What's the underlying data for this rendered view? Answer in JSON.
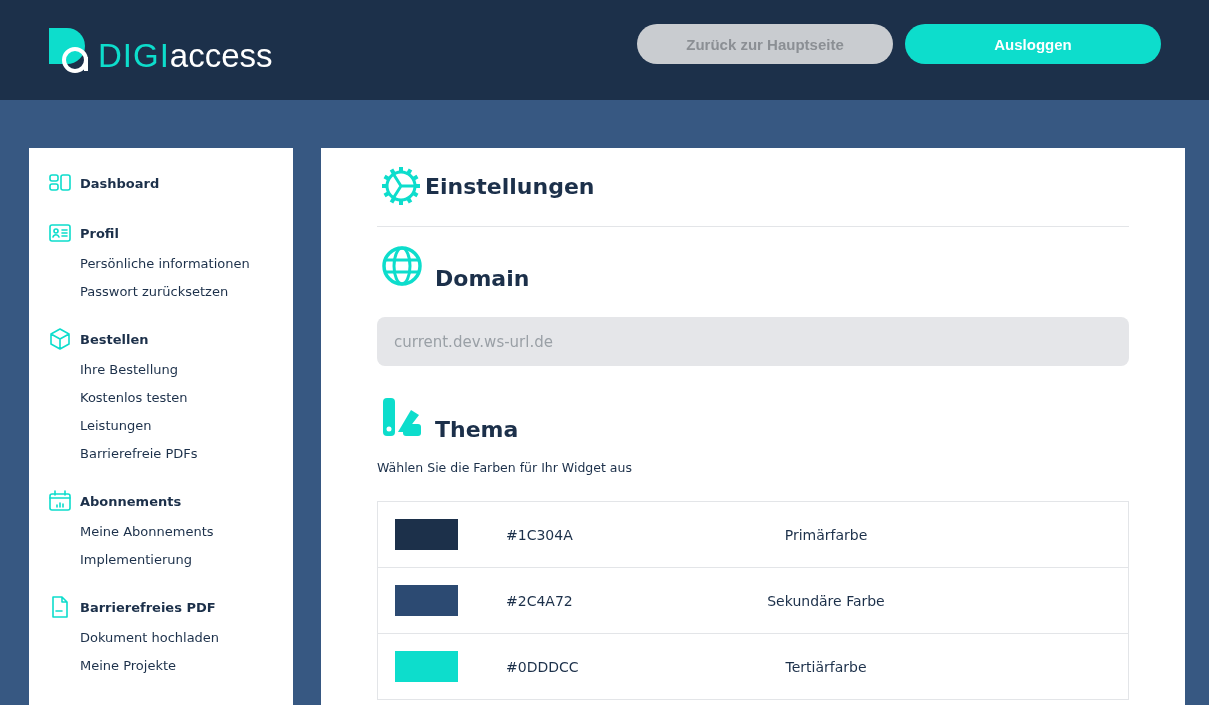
{
  "header": {
    "logo": {
      "part_1": "DIGI",
      "part_2": "access"
    },
    "buttons": [
      {
        "label": "Zurück zur Hauptseite",
        "kind": "secondary"
      },
      {
        "label": "Ausloggen",
        "kind": "primary"
      }
    ]
  },
  "sidebar": {
    "sections": [
      {
        "title": "Dashboard"
      },
      {
        "title": "Profil",
        "items": [
          "Persönliche informationen",
          "Passwort zurücksetzen"
        ]
      },
      {
        "title": "Bestellen",
        "items": [
          "Ihre Bestellung",
          "Kostenlos testen",
          "Leistungen",
          "Barrierefreie PDFs"
        ]
      },
      {
        "title": "Abonnements",
        "items": [
          "Meine Abonnements",
          "Implementierung"
        ]
      },
      {
        "title": "Barrierefreies PDF",
        "items": [
          "Dokument hochladen",
          "Meine Projekte"
        ]
      }
    ]
  },
  "main": {
    "title": "Einstellungen",
    "domain": {
      "title": "Domain",
      "placeholder": "current.dev.ws-url.de"
    },
    "theme": {
      "title": "Thema",
      "description": "Wählen Sie die Farben für Ihr Widget aus",
      "colors": [
        {
          "color": "#1c304a",
          "code": "#1C304A",
          "name": "Primärfarbe"
        },
        {
          "color": "#2c4a72",
          "code": "#2C4A72",
          "name": "Sekundäre Farbe"
        },
        {
          "color": "#0dddcc",
          "code": "#0DDDCC",
          "name": "Tertiärfarbe"
        }
      ]
    }
  }
}
